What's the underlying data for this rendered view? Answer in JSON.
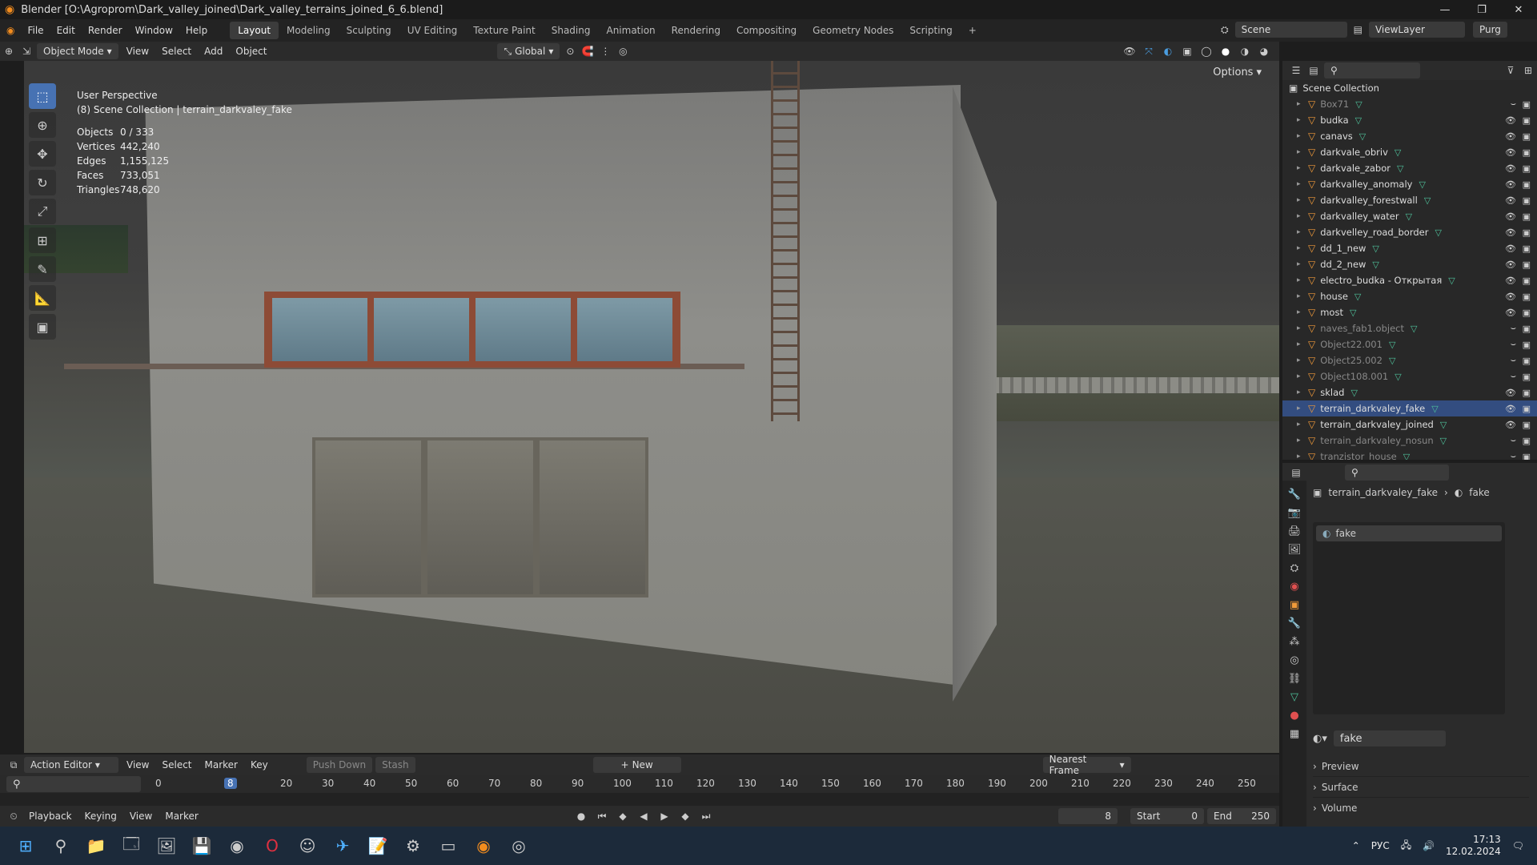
{
  "window": {
    "title": "Blender [O:\\Agroprom\\Dark_valley_joined\\Dark_valley_terrains_joined_6_6.blend]"
  },
  "menu": [
    "File",
    "Edit",
    "Render",
    "Window",
    "Help"
  ],
  "workspaces": [
    "Layout",
    "Modeling",
    "Sculpting",
    "UV Editing",
    "Texture Paint",
    "Shading",
    "Animation",
    "Rendering",
    "Compositing",
    "Geometry Nodes",
    "Scripting"
  ],
  "scene": {
    "label": "Scene",
    "viewlayer": "ViewLayer",
    "purge": "Purg"
  },
  "viewport": {
    "mode": "Object Mode",
    "menus": [
      "View",
      "Select",
      "Add",
      "Object"
    ],
    "transform": "Global",
    "options": "Options",
    "overlay_line1": "User Perspective",
    "overlay_line2": "(8) Scene Collection | terrain_darkvaley_fake",
    "stats": [
      {
        "k": "Objects",
        "v": "0 / 333"
      },
      {
        "k": "Vertices",
        "v": "442,240"
      },
      {
        "k": "Edges",
        "v": "1,155,125"
      },
      {
        "k": "Faces",
        "v": "733,051"
      },
      {
        "k": "Triangles",
        "v": "748,620"
      }
    ]
  },
  "outliner": {
    "root": "Scene Collection",
    "items": [
      {
        "name": "Box71",
        "dim": true
      },
      {
        "name": "budka"
      },
      {
        "name": "canavs"
      },
      {
        "name": "darkvale_obriv"
      },
      {
        "name": "darkvale_zabor"
      },
      {
        "name": "darkvalley_anomaly"
      },
      {
        "name": "darkvalley_forestwall"
      },
      {
        "name": "darkvalley_water"
      },
      {
        "name": "darkvelley_road_border"
      },
      {
        "name": "dd_1_new"
      },
      {
        "name": "dd_2_new"
      },
      {
        "name": "electro_budka - Открытая"
      },
      {
        "name": "house"
      },
      {
        "name": "most"
      },
      {
        "name": "naves_fab1.object",
        "dim": true
      },
      {
        "name": "Object22.001",
        "dim": true
      },
      {
        "name": "Object25.002",
        "dim": true
      },
      {
        "name": "Object108.001",
        "dim": true
      },
      {
        "name": "sklad"
      },
      {
        "name": "terrain_darkvaley_fake",
        "sel": true
      },
      {
        "name": "terrain_darkvaley_joined"
      },
      {
        "name": "terrain_darkvaley_nosun",
        "dim": true
      },
      {
        "name": "tranzistor_house",
        "dim": true
      }
    ]
  },
  "properties": {
    "object": "terrain_darkvaley_fake",
    "material": "fake",
    "slot": "fake",
    "matfield": "fake",
    "panels": [
      "Preview",
      "Surface",
      "Volume"
    ]
  },
  "timeline": {
    "editor": "Action Editor",
    "menus": [
      "View",
      "Select",
      "Marker",
      "Key"
    ],
    "push": "Push Down",
    "stash": "Stash",
    "new": "New",
    "snap": "Nearest Frame",
    "ticks": [
      "0",
      "8",
      "20",
      "30",
      "40",
      "50",
      "60",
      "70",
      "80",
      "90",
      "100",
      "110",
      "120",
      "130",
      "140",
      "150",
      "160",
      "170",
      "180",
      "190",
      "200",
      "210",
      "220",
      "230",
      "240",
      "250"
    ],
    "playback": "Playback",
    "keying": "Keying",
    "view": "View",
    "marker": "Marker",
    "frame": "8",
    "start_label": "Start",
    "start": "0",
    "end_label": "End",
    "end": "250"
  },
  "taskbar": {
    "lang": "РУС",
    "time": "17:13",
    "date": "12.02.2024"
  }
}
